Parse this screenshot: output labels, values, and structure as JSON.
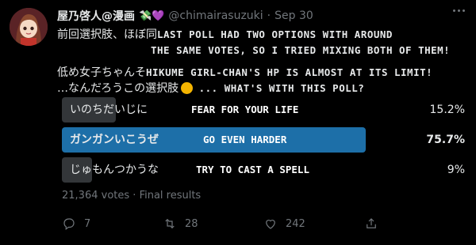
{
  "user": {
    "display_name": "屋乃啓人@漫画",
    "name_emoji": "💸💜",
    "handle": "@chimairasuzuki",
    "separator": "·",
    "date": "Sep 30"
  },
  "body": {
    "line1_jp": "前回選択肢、ほぼ同",
    "line1_en_a": "LAST POLL HAD TWO OPTIONS WITH AROUND",
    "line1_en_b": "THE SAME VOTES, SO I TRIED MIXING BOTH OF THEM!",
    "line2_jp": "低め女子ちゃんそ",
    "line2_en": "HIKUME GIRL-CHAN'S HP IS ALMOST AT ITS LIMIT!",
    "line3_jp": "…なんだろうこの選択肢",
    "line3_en": "... WHAT'S WITH THIS POLL?"
  },
  "poll": {
    "options": [
      {
        "label": "いのちだいじに",
        "translation": "FEAR FOR YOUR LIFE",
        "percent": "15.2%",
        "value": 15.2
      },
      {
        "label": "ガンガンいこうぜ",
        "translation": "GO EVEN HARDER",
        "percent": "75.7%",
        "value": 75.7
      },
      {
        "label": "じゅもんつかうな",
        "translation": "TRY TO CAST A SPELL",
        "percent": "9%",
        "value": 9
      }
    ],
    "votes": "21,364 votes",
    "dot": "·",
    "status": "Final results"
  },
  "actions": {
    "replies": "7",
    "retweets": "28",
    "likes": "242"
  },
  "colors": {
    "winner_bar": "#1d6fa8",
    "loser_bar": "#333639",
    "muted": "#71767b"
  }
}
